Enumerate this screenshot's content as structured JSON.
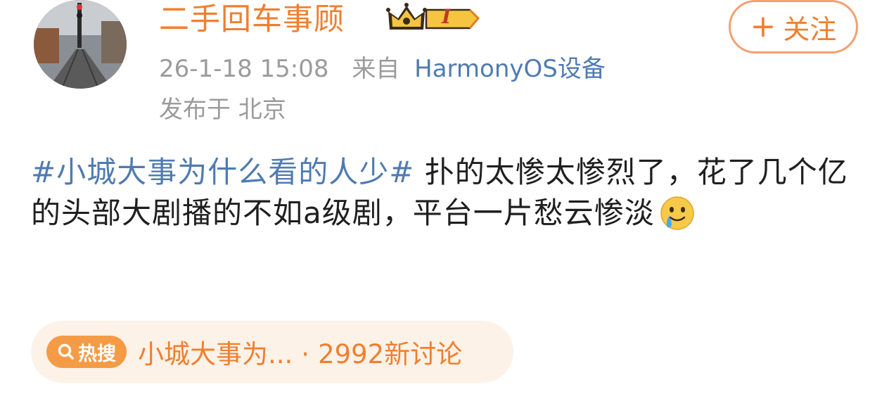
{
  "user": {
    "name": "二手回车事顾",
    "vip_level": "I"
  },
  "follow": {
    "plus": "+",
    "label": "关注"
  },
  "meta": {
    "time": "26-1-18 15:08",
    "source_prefix": "来自",
    "device": "HarmonyOS设备",
    "location": "发布于 北京"
  },
  "post": {
    "topic": "#小城大事为什么看的人少#",
    "text": " 扑的太惨太惨烈了，花了几个亿的头部大剧播的不如a级剧，平台一片愁云惨淡",
    "emoji": "tearful-smile-emoji"
  },
  "hot_search": {
    "badge": "热搜",
    "topic": "小城大事为...",
    "separator": "·",
    "count": "2992新讨论"
  },
  "colors": {
    "accent_orange": "#f07f2f",
    "link_blue": "#4f7bb0",
    "meta_gray": "#9b9b9b",
    "pill_bg": "#fdf2e8"
  }
}
